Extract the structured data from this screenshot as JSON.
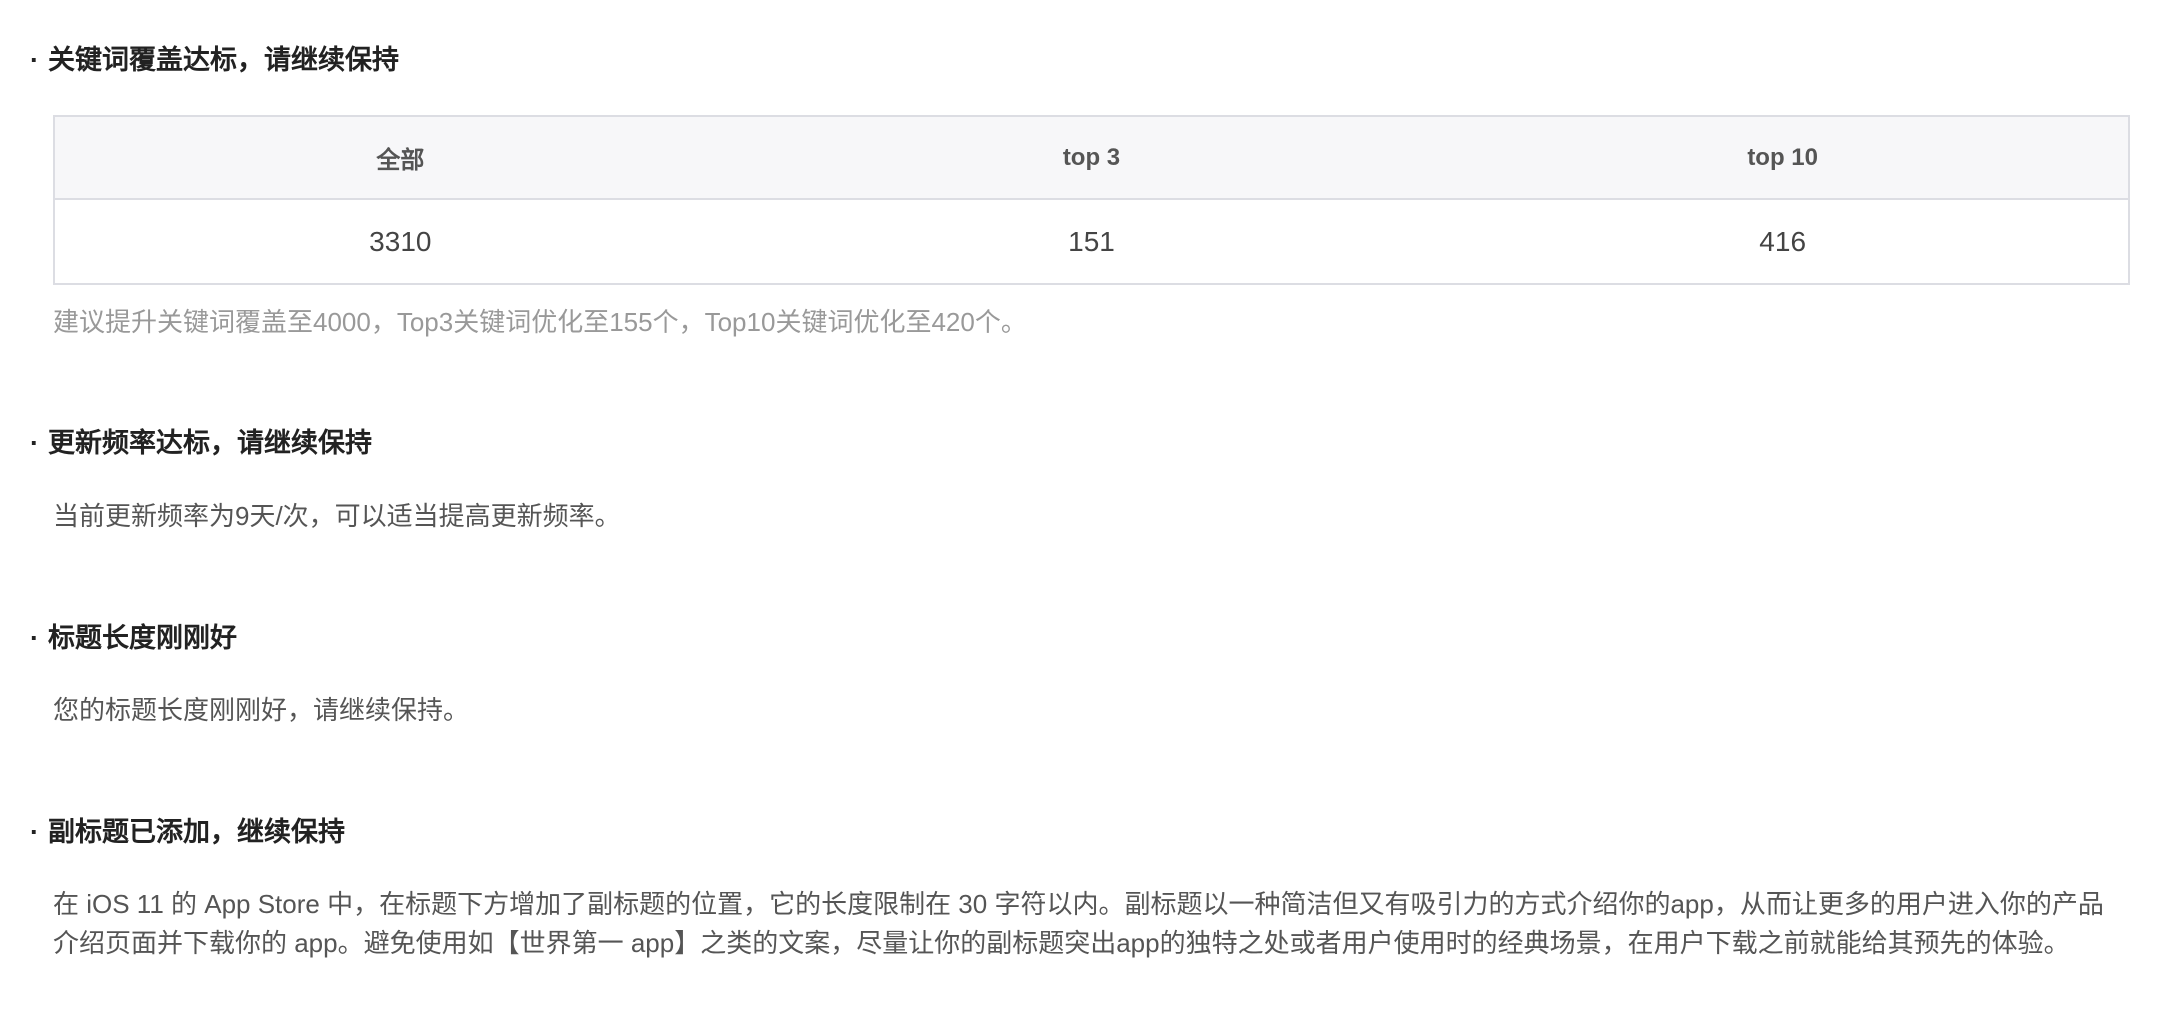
{
  "sections": [
    {
      "bullet": "·",
      "title": "关键词覆盖达标，请继续保持",
      "table": {
        "headers": [
          "全部",
          "top 3",
          "top 10"
        ],
        "values": [
          "3310",
          "151",
          "416"
        ]
      },
      "text": "建议提升关键词覆盖至4000，Top3关键词优化至155个，Top10关键词优化至420个。"
    },
    {
      "bullet": "·",
      "title": "更新频率达标，请继续保持",
      "text": "当前更新频率为9天/次，可以适当提高更新频率。"
    },
    {
      "bullet": "·",
      "title": "标题长度刚刚好",
      "text": "您的标题长度刚刚好，请继续保持。"
    },
    {
      "bullet": "·",
      "title": "副标题已添加，继续保持",
      "text_lines": [
        "在 iOS 11 的 App Store 中，在标题下方增加了副标题的位置，它的长度限制在 30 字符以内。副标题以一种简洁但又有吸引力的方式介绍你的app，从而让更多的用户进入你的产品",
        "介绍页面并下载你的 app。避免使用如【世界第一 app】之类的文案，尽量让你的副标题突出app的独特之处或者用户使用时的经典场景，在用户下载之前就能给其预先的体验。"
      ]
    }
  ]
}
